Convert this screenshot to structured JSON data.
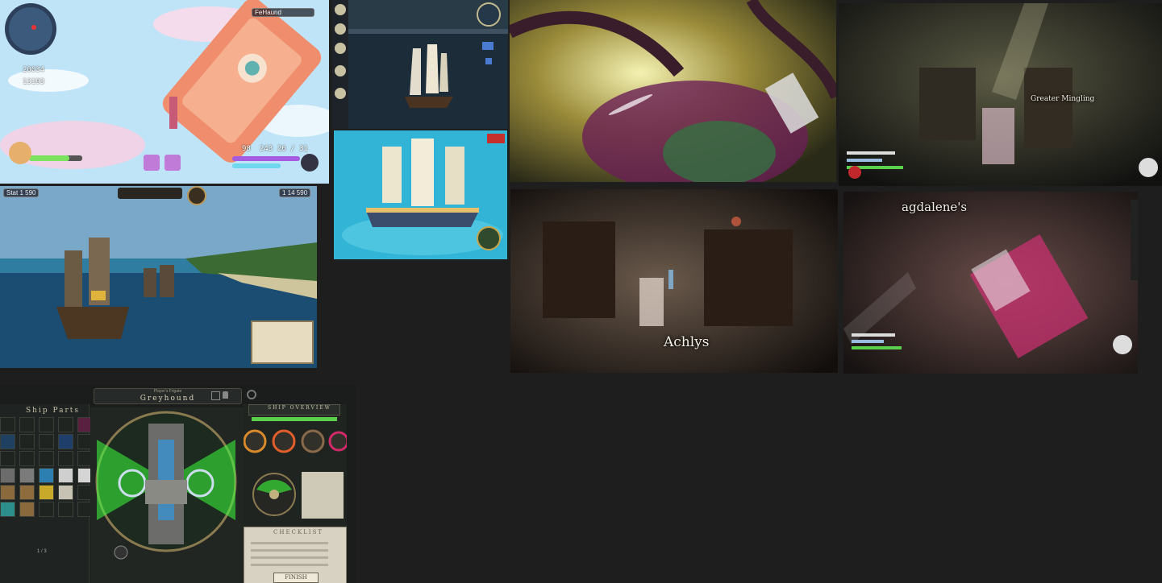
{
  "tiles": {
    "sky": {
      "score_1": "20034",
      "score_2": "13193",
      "hud_top": "FeHaund",
      "hud_s1": "98",
      "hud_s2": "243",
      "hud_s3": "26 / 31"
    },
    "galleon": {
      "hud_left": "Stat 1 590",
      "hud_right": "1 14 590"
    },
    "cinematic_2": {
      "label": "Greater Mingling"
    },
    "cinematic_3": {
      "label": "Achlys"
    },
    "cinematic_4": {
      "label": "agdalene's"
    },
    "shipyard": {
      "ship_subtitle": "Player's Frigate",
      "ship_name": "Greyhound",
      "parts_title": "Ship Parts",
      "overview_title": "SHIP OVERVIEW",
      "checklist_title": "CHECKLIST",
      "finish_label": "FINISH",
      "page_indicator": "1 / 3"
    }
  },
  "colors": {
    "background": "#1e1e1e",
    "yard_green": "#3cff3c"
  }
}
